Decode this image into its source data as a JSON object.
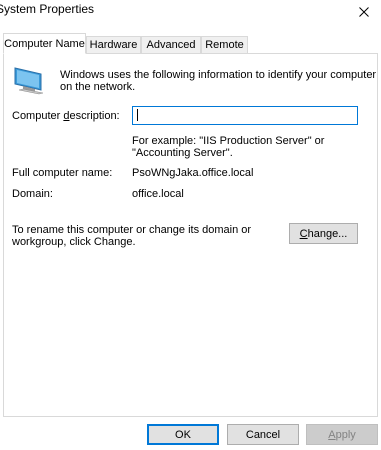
{
  "window": {
    "title": "System Properties",
    "close_glyph": "✕"
  },
  "tabs": [
    {
      "label": "Computer Name",
      "active": true
    },
    {
      "label": "Hardware",
      "active": false
    },
    {
      "label": "Advanced",
      "active": false
    },
    {
      "label": "Remote",
      "active": false
    }
  ],
  "computer_name_tab": {
    "intro_line1": "Windows uses the following information to identify your computer",
    "intro_line2": "on the network.",
    "description_label": "Computer description:",
    "description_value": "",
    "example_line1": "For example: \"IIS Production Server\" or",
    "example_line2": "\"Accounting Server\".",
    "full_name_label": "Full computer name:",
    "full_name_value": "PsoWNgJaka.office.local",
    "domain_label": "Domain:",
    "domain_value": "office.local",
    "rename_line1": "To rename this computer or change its domain or",
    "rename_line2": "workgroup, click Change.",
    "change_button": "Change..."
  },
  "footer": {
    "ok_label": "OK",
    "cancel_label": "Cancel",
    "apply_label": "Apply"
  },
  "icons": {
    "computer": "computer-icon",
    "close": "close-icon"
  }
}
